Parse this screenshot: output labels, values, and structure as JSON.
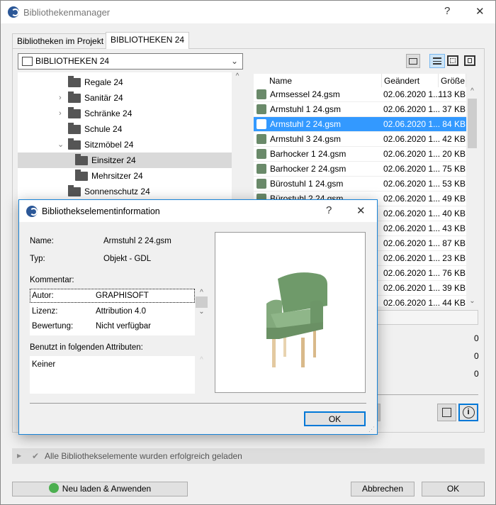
{
  "window": {
    "title": "Bibliothekenmanager",
    "help": "?",
    "close": "✕"
  },
  "tabs": [
    {
      "label": "Bibliotheken im Projekt"
    },
    {
      "label": "BIBLIOTHEKEN 24"
    }
  ],
  "library_dropdown": {
    "value": "BIBLIOTHEKEN 24"
  },
  "tree": [
    {
      "label": "Regale 24"
    },
    {
      "label": "Sanitär 24"
    },
    {
      "label": "Schränke 24"
    },
    {
      "label": "Schule 24"
    },
    {
      "label": "Sitzmöbel 24"
    },
    {
      "label": "Einsitzer 24"
    },
    {
      "label": "Mehrsitzer 24"
    },
    {
      "label": "Sonnenschutz 24"
    }
  ],
  "file_list": {
    "headers": {
      "name": "Name",
      "changed": "Geändert",
      "size": "Größe"
    },
    "rows": [
      {
        "name": "Armsessel 24.gsm",
        "changed": "02.06.2020 1...",
        "size": "113 KB"
      },
      {
        "name": "Armstuhl 1 24.gsm",
        "changed": "02.06.2020 1...",
        "size": "37 KB"
      },
      {
        "name": "Armstuhl 2 24.gsm",
        "changed": "02.06.2020 1...",
        "size": "84 KB"
      },
      {
        "name": "Armstuhl 3 24.gsm",
        "changed": "02.06.2020 1...",
        "size": "42 KB"
      },
      {
        "name": "Barhocker 1 24.gsm",
        "changed": "02.06.2020 1...",
        "size": "20 KB"
      },
      {
        "name": "Barhocker 2 24.gsm",
        "changed": "02.06.2020 1...",
        "size": "75 KB"
      },
      {
        "name": "Bürostuhl 1 24.gsm",
        "changed": "02.06.2020 1...",
        "size": "53 KB"
      },
      {
        "name": "Bürostuhl 2 24.gsm",
        "changed": "02.06.2020 1...",
        "size": "49 KB"
      },
      {
        "name": "",
        "changed": "02.06.2020 1...",
        "size": "40 KB"
      },
      {
        "name": "",
        "changed": "02.06.2020 1...",
        "size": "43 KB"
      },
      {
        "name": "",
        "changed": "02.06.2020 1...",
        "size": "87 KB"
      },
      {
        "name": "",
        "changed": "02.06.2020 1...",
        "size": "23 KB"
      },
      {
        "name": "",
        "changed": "02.06.2020 1...",
        "size": "76 KB"
      },
      {
        "name": "",
        "changed": "02.06.2020 1...",
        "size": "39 KB"
      },
      {
        "name": "",
        "changed": "02.06.2020 1...",
        "size": "44 KB"
      }
    ]
  },
  "counts": [
    "0",
    "0",
    "0"
  ],
  "status": "Alle Bibliothekselemente wurden erfolgreich geladen",
  "buttons": {
    "reload": "Neu laden & Anwenden",
    "cancel": "Abbrechen",
    "ok": "OK"
  },
  "dialog": {
    "title": "Bibliothekselementinformation",
    "help": "?",
    "close": "✕",
    "name_label": "Name:",
    "name_value": "Armstuhl 2 24.gsm",
    "type_label": "Typ:",
    "type_value": "Objekt - GDL",
    "comment_label": "Kommentar:",
    "comments": [
      {
        "key": "Autor:",
        "value": "GRAPHISOFT"
      },
      {
        "key": "Lizenz:",
        "value": "Attribution 4.0"
      },
      {
        "key": "Bewertung:",
        "value": "Nicht verfügbar"
      }
    ],
    "used_label": "Benutzt in folgenden Attributen:",
    "used_value": "Keiner",
    "ok": "OK"
  },
  "colors": {
    "accent": "#3399ff",
    "focus": "#0078d7"
  }
}
